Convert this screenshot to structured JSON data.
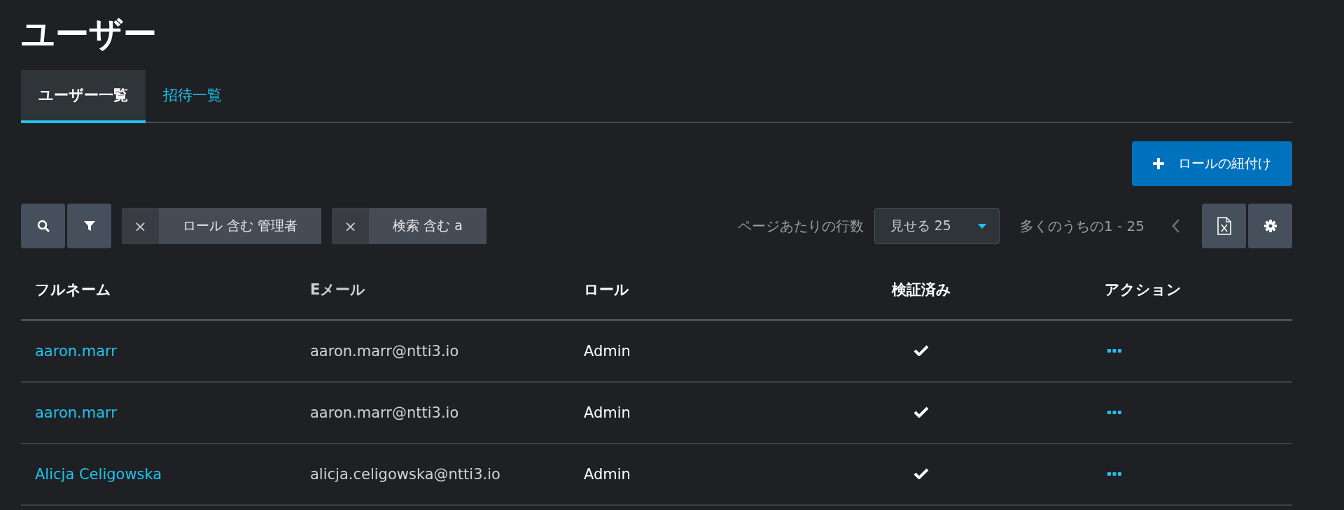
{
  "page_title": "ユーザー",
  "tabs": [
    {
      "label": "ユーザー一覧",
      "selected": true
    },
    {
      "label": "招待一覧",
      "selected": false
    }
  ],
  "primary_button": {
    "label": "ロールの紐付け"
  },
  "filters": [
    {
      "remove": "×",
      "label": "ロール 含む 管理者"
    },
    {
      "remove": "×",
      "label": "検索 含む a"
    }
  ],
  "pagination": {
    "rows_per_page_label": "ページあたりの行数",
    "rows_per_page": "見せる 25",
    "range": "多くのうちの1 - 25"
  },
  "table": {
    "columns": [
      "フルネーム",
      "Eメール",
      "ロール",
      "検証済み",
      "アクション"
    ],
    "rows": [
      {
        "full_name": "aaron.marr",
        "email": "aaron.marr@ntti3.io",
        "role": "Admin",
        "verified": true
      },
      {
        "full_name": "aaron.marr",
        "email": "aaron.marr@ntti3.io",
        "role": "Admin",
        "verified": true
      },
      {
        "full_name": "Alicja Celigowska",
        "email": "alicja.celigowska@ntti3.io",
        "role": "Admin",
        "verified": true
      }
    ]
  }
}
